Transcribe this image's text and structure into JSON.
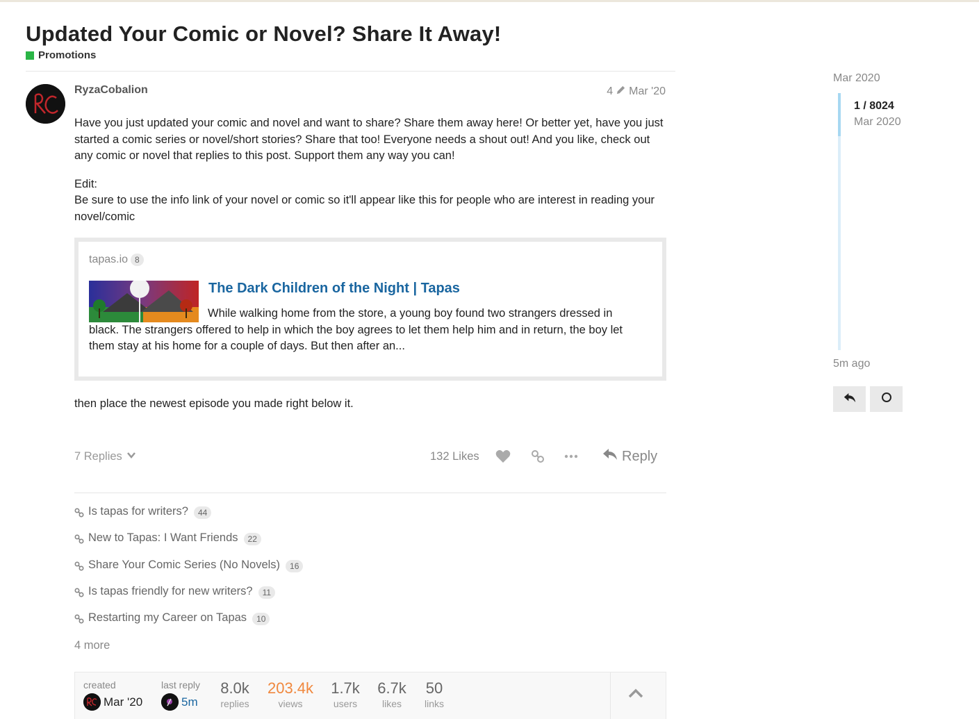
{
  "topic": {
    "title": "Updated Your Comic or Novel? Share It Away!",
    "category": {
      "name": "Promotions",
      "color": "#2ab546"
    }
  },
  "post": {
    "username": "RyzaCobalion",
    "edits": "4",
    "date": "Mar '20",
    "paragraphs": [
      "Have you just updated your comic and novel and want to share? Share them away here! Or better yet, have you just started a comic series or novel/short stories? Share that too! Everyone needs a shout out! And you like, check out any comic or novel that replies to this post. Support them any way you can!",
      "Be sure to use the info link of your novel or comic so it'll appear like this for people who are interest in reading your novel/comic"
    ],
    "edit_label": "Edit:",
    "after_text": "then place the newest episode you made right below it.",
    "onebox": {
      "source": "tapas.io",
      "source_count": "8",
      "title": "The Dark Children of the Night | Tapas",
      "description": "While walking home from the store, a young boy found two strangers dressed in black. The strangers offered to help in which the boy agrees to let them help him and in return, the boy let them stay at his home for a couple of days. But then after an..."
    },
    "actions": {
      "replies_label": "7 Replies",
      "likes_label": "132 Likes",
      "reply_label": "Reply",
      "icons": [
        "heart-icon",
        "link-icon",
        "ellipsis-icon",
        "reply-icon"
      ]
    }
  },
  "linked_topics": [
    {
      "title": "Is tapas for writers?",
      "count": "44"
    },
    {
      "title": "New to Tapas: I Want Friends",
      "count": "22"
    },
    {
      "title": "Share Your Comic Series (No Novels)",
      "count": "16"
    },
    {
      "title": "Is tapas friendly for new writers?",
      "count": "11"
    },
    {
      "title": "Restarting my Career on Tapas",
      "count": "10"
    }
  ],
  "more_links": "4 more",
  "topic_map": {
    "created_label": "created",
    "created_date": "Mar '20",
    "last_reply_label": "last reply",
    "last_reply_time": "5m",
    "stats": [
      {
        "value": "8.0k",
        "label": "replies",
        "color": "#666666"
      },
      {
        "value": "203.4k",
        "label": "views",
        "color": "#f0883e"
      },
      {
        "value": "1.7k",
        "label": "users",
        "color": "#666666"
      },
      {
        "value": "6.7k",
        "label": "likes",
        "color": "#666666"
      },
      {
        "value": "50",
        "label": "links",
        "color": "#666666"
      }
    ]
  },
  "timeline": {
    "start_date": "Mar 2020",
    "position": "1 / 8024",
    "position_date": "Mar 2020",
    "end_label": "5m ago"
  }
}
